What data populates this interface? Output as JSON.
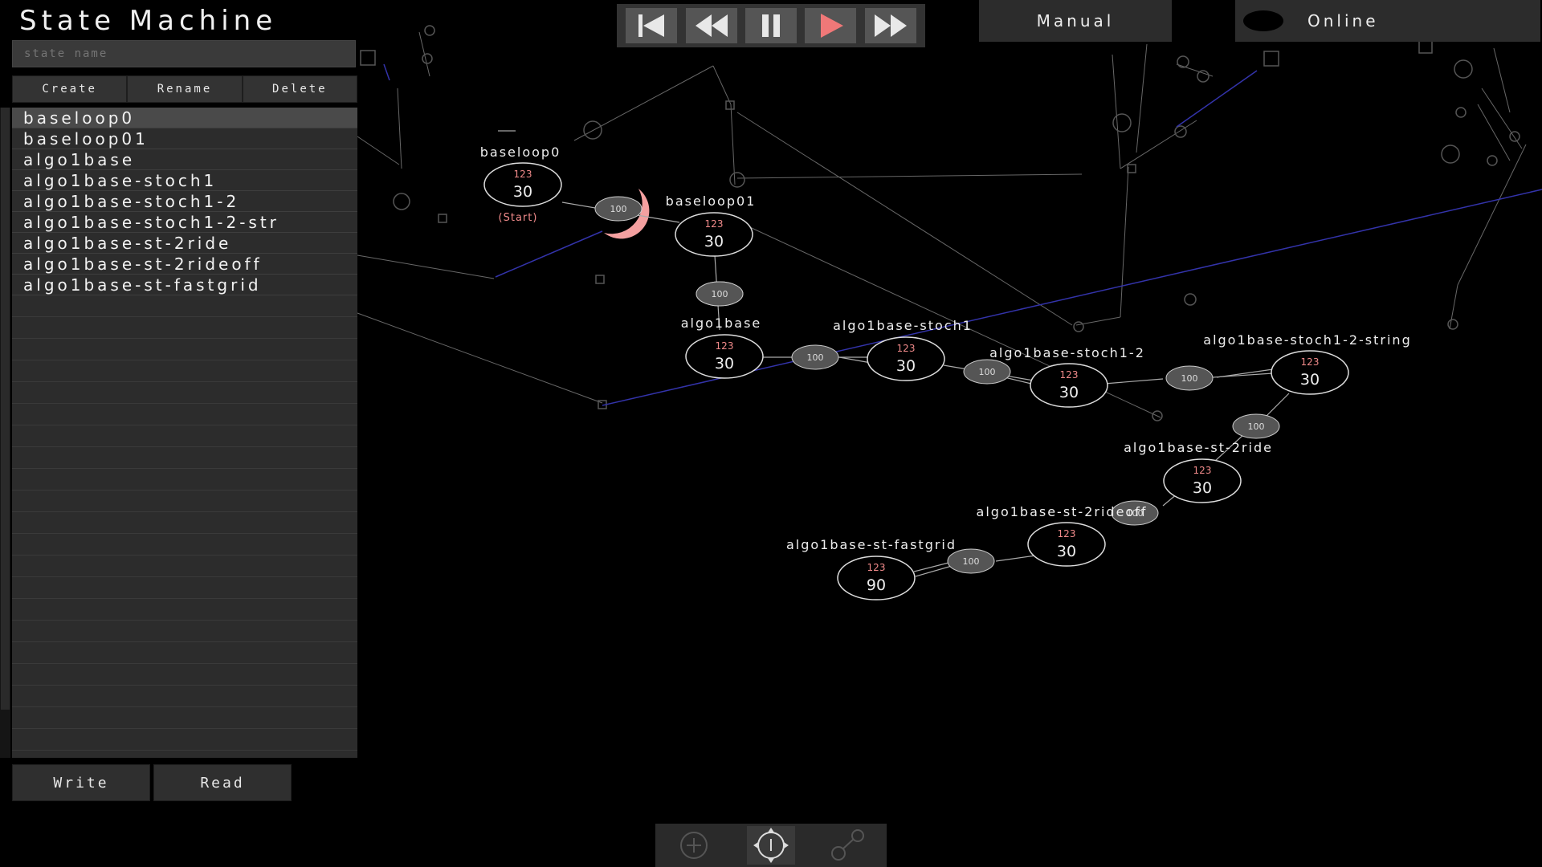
{
  "app": {
    "title": "State Machine"
  },
  "state_name_input": {
    "placeholder": "state name",
    "value": "state name"
  },
  "actions": {
    "create": "Create",
    "rename": "Rename",
    "delete": "Delete"
  },
  "states": [
    "baseloop0",
    "baseloop01",
    "algo1base",
    "algo1base-stoch1",
    "algo1base-stoch1-2",
    "algo1base-stoch1-2-str",
    "algo1base-st-2ride",
    "algo1base-st-2rideoff",
    "algo1base-st-fastgrid"
  ],
  "selected_state": "baseloop0",
  "footer": {
    "write": "Write",
    "read": "Read"
  },
  "transport": {
    "buttons": [
      "skip-to-start",
      "rewind",
      "pause",
      "play",
      "fast-forward"
    ],
    "play_color": "#f07878"
  },
  "mode_label": "Manual",
  "status_label": "Online",
  "graph": {
    "start_label": "(Start)",
    "nodes": [
      {
        "name": "baseloop0",
        "top": "123",
        "value": "30"
      },
      {
        "name": "baseloop01",
        "top": "123",
        "value": "30"
      },
      {
        "name": "algo1base",
        "top": "123",
        "value": "30"
      },
      {
        "name": "algo1base-stoch1",
        "top": "123",
        "value": "30"
      },
      {
        "name": "algo1base-stoch1-2",
        "top": "123",
        "value": "30"
      },
      {
        "name": "algo1base-stoch1-2-string",
        "top": "123",
        "value": "30"
      },
      {
        "name": "algo1base-st-2ride",
        "top": "123",
        "value": "30"
      },
      {
        "name": "algo1base-st-2rideoff",
        "top": "123",
        "value": "30"
      },
      {
        "name": "algo1base-st-fastgrid",
        "top": "123",
        "value": "90"
      }
    ],
    "transition_label": "100",
    "node_accent": "#f08a8a",
    "active_arc_color": "#f4a0a0",
    "link_color": "#3333aa"
  },
  "tools": [
    "add-icon",
    "move-cursor-icon",
    "connect-icon"
  ]
}
